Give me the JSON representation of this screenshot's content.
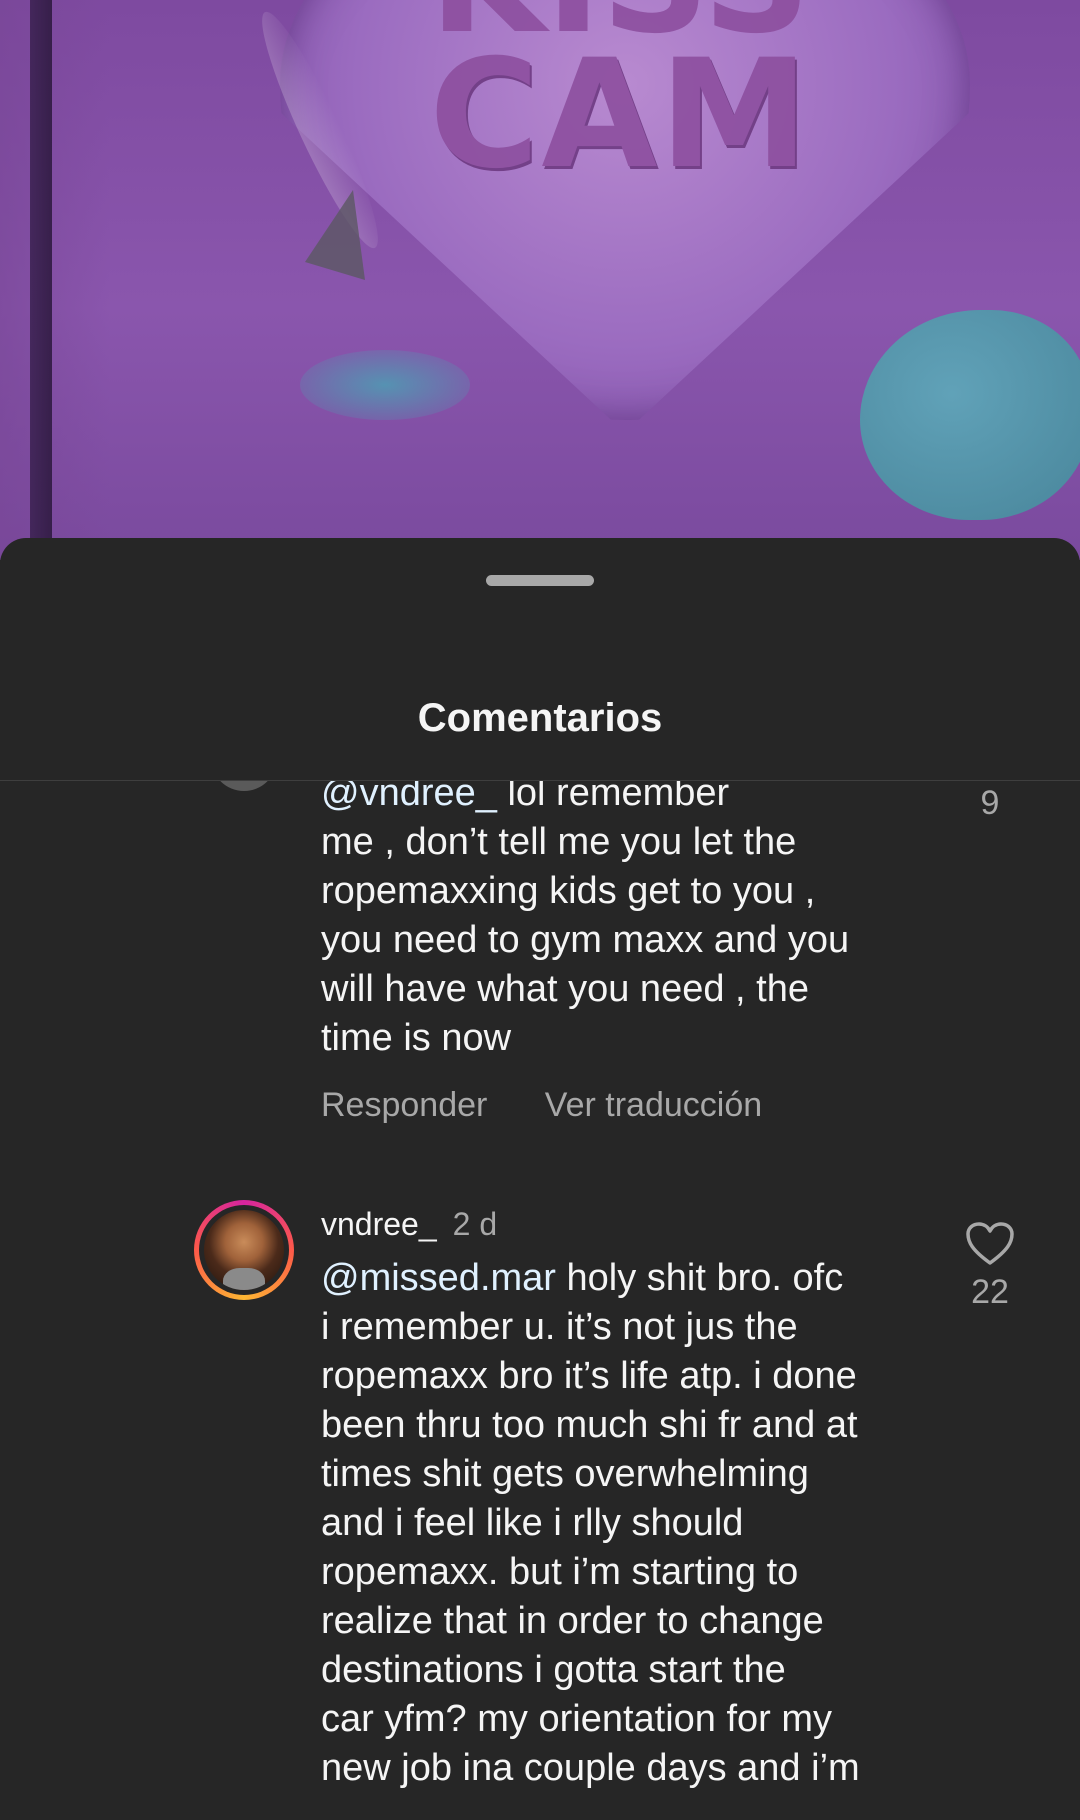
{
  "video": {
    "sign_text_top": "KISS",
    "sign_text": "CAM"
  },
  "sheet": {
    "title": "Comentarios"
  },
  "comments": [
    {
      "mention": "@vndree_",
      "text": " lol remember\nme , don’t tell me you let the\nropemaxxing kids get to you ,\nyou need to gym maxx and you\nwill have what you need , the\ntime is now",
      "likes": "9",
      "reply_label": "Responder",
      "translate_label": "Ver traducción"
    },
    {
      "username": "vndree_",
      "time": "2 d",
      "mention": "@missed.mar",
      "text": " holy shit bro. ofc\ni remember u. it’s not jus the\nropemaxx bro it’s life atp. i done\nbeen thru too much shi fr and at\ntimes shit gets overwhelming\nand i feel like i rlly should\nropemaxx. but i’m starting to\nrealize that in order to change\ndestinations i gotta start the\ncar yfm? my orientation for my\nnew job ina couple days and i’m",
      "likes": "22",
      "like_icon": "heart-outline-icon"
    }
  ],
  "colors": {
    "sheet_bg": "#262626",
    "secondary_text": "#a8a8a8",
    "mention": "#e0f1ff"
  }
}
